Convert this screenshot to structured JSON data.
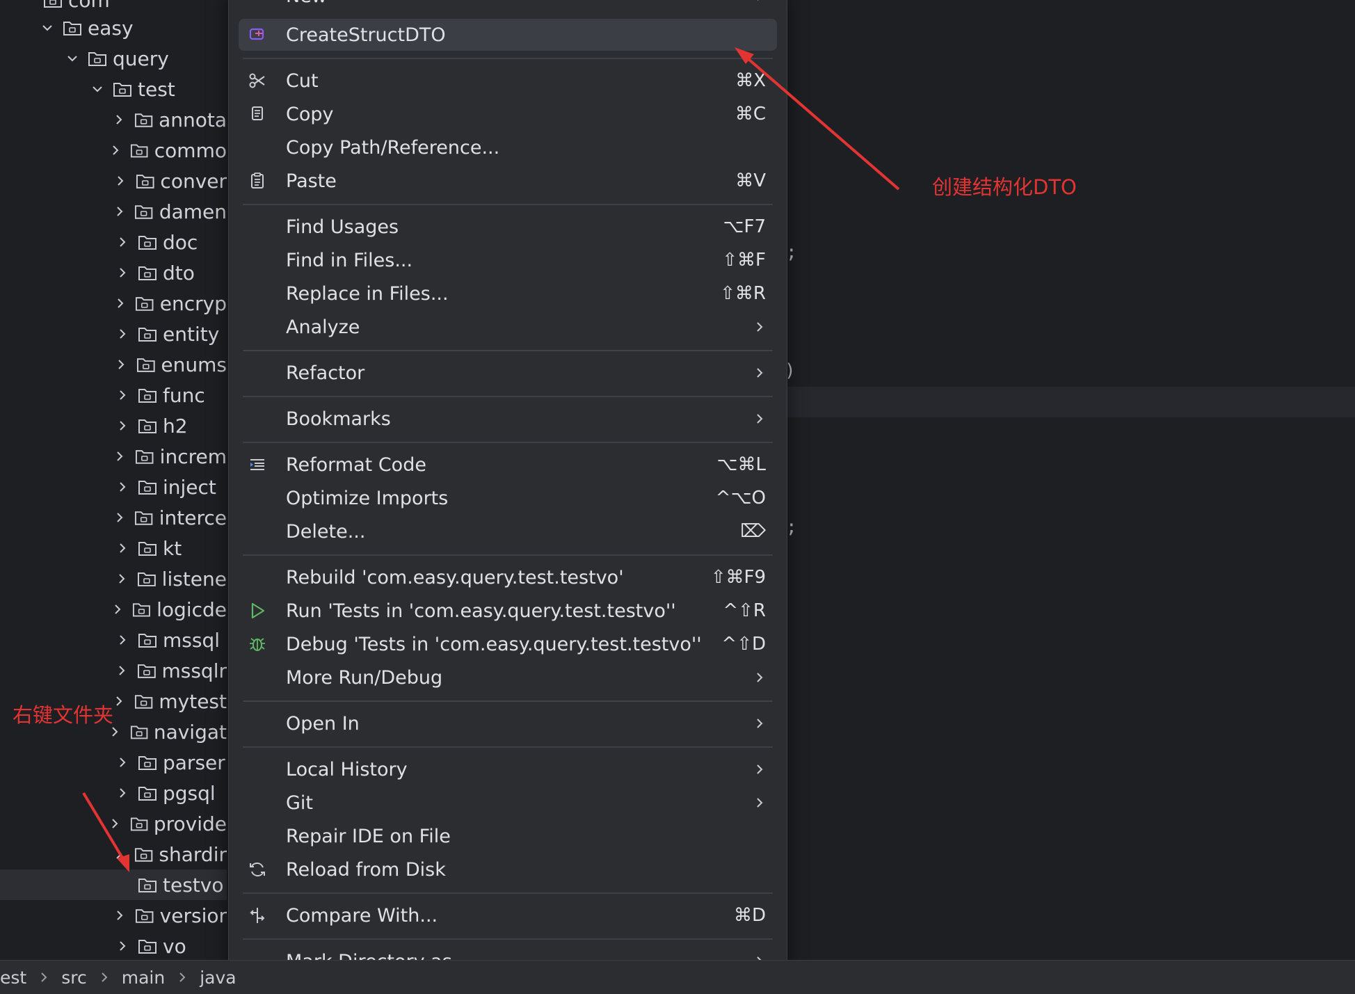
{
  "tree": {
    "top_partial": "com",
    "expanded": [
      {
        "label": "easy"
      },
      {
        "label": "query"
      },
      {
        "label": "test"
      }
    ],
    "children": [
      {
        "label": "annota"
      },
      {
        "label": "commo"
      },
      {
        "label": "conver"
      },
      {
        "label": "damen"
      },
      {
        "label": "doc"
      },
      {
        "label": "dto"
      },
      {
        "label": "encryp"
      },
      {
        "label": "entity"
      },
      {
        "label": "enums"
      },
      {
        "label": "func"
      },
      {
        "label": "h2"
      },
      {
        "label": "increm"
      },
      {
        "label": "inject"
      },
      {
        "label": "interce"
      },
      {
        "label": "kt"
      },
      {
        "label": "listene"
      },
      {
        "label": "logicde"
      },
      {
        "label": "mssql"
      },
      {
        "label": "mssqlr"
      },
      {
        "label": "mytest"
      },
      {
        "label": "navigat"
      },
      {
        "label": "parser"
      },
      {
        "label": "pgsql"
      },
      {
        "label": "provide"
      },
      {
        "label": "shardir"
      },
      {
        "label": "testvo"
      },
      {
        "label": "versior"
      },
      {
        "label": "vo"
      }
    ]
  },
  "menu": {
    "top_partial": "New",
    "items": {
      "create_struct_dto": {
        "label": "CreateStructDTO"
      },
      "cut": {
        "label": "Cut",
        "shortcut": "⌘X"
      },
      "copy": {
        "label": "Copy",
        "shortcut": "⌘C"
      },
      "copy_path": {
        "label": "Copy Path/Reference..."
      },
      "paste": {
        "label": "Paste",
        "shortcut": "⌘V"
      },
      "find_usages": {
        "label": "Find Usages",
        "shortcut": "⌥F7"
      },
      "find_in_files": {
        "label": "Find in Files...",
        "shortcut": "⇧⌘F"
      },
      "replace_in_files": {
        "label": "Replace in Files...",
        "shortcut": "⇧⌘R"
      },
      "analyze": {
        "label": "Analyze"
      },
      "refactor": {
        "label": "Refactor"
      },
      "bookmarks": {
        "label": "Bookmarks"
      },
      "reformat": {
        "label": "Reformat Code",
        "shortcut": "⌥⌘L"
      },
      "optimize_imports": {
        "label": "Optimize Imports",
        "shortcut": "^⌥O"
      },
      "delete": {
        "label": "Delete...",
        "shortcut": "⌦"
      },
      "rebuild": {
        "label": "Rebuild 'com.easy.query.test.testvo'",
        "shortcut": "⇧⌘F9"
      },
      "run": {
        "label": "Run 'Tests in 'com.easy.query.test.testvo''",
        "shortcut": "^⇧R"
      },
      "debug": {
        "label": "Debug 'Tests in 'com.easy.query.test.testvo''",
        "shortcut": "^⇧D"
      },
      "more_run_debug": {
        "label": "More Run/Debug"
      },
      "open_in": {
        "label": "Open In"
      },
      "local_history": {
        "label": "Local History"
      },
      "git": {
        "label": "Git"
      },
      "repair_ide": {
        "label": "Repair IDE on File"
      },
      "reload": {
        "label": "Reload from Disk"
      },
      "compare": {
        "label": "Compare With...",
        "shortcut": "⌘D"
      },
      "mark_directory": {
        "label": "Mark Directory as"
      }
    }
  },
  "editor": {
    "frag1": ";",
    "frag2": ")",
    "frag3": ";"
  },
  "status": {
    "crumbs": [
      "est",
      "src",
      "main",
      "java"
    ]
  },
  "annotations": {
    "create_dto": "创建结构化DTO",
    "right_click": "右键文件夹"
  },
  "colors": {
    "annotation": "#e33434",
    "run_icon": "#5fb865",
    "debug_icon": "#5fb865",
    "dto_icon": "#8b5cf6"
  }
}
